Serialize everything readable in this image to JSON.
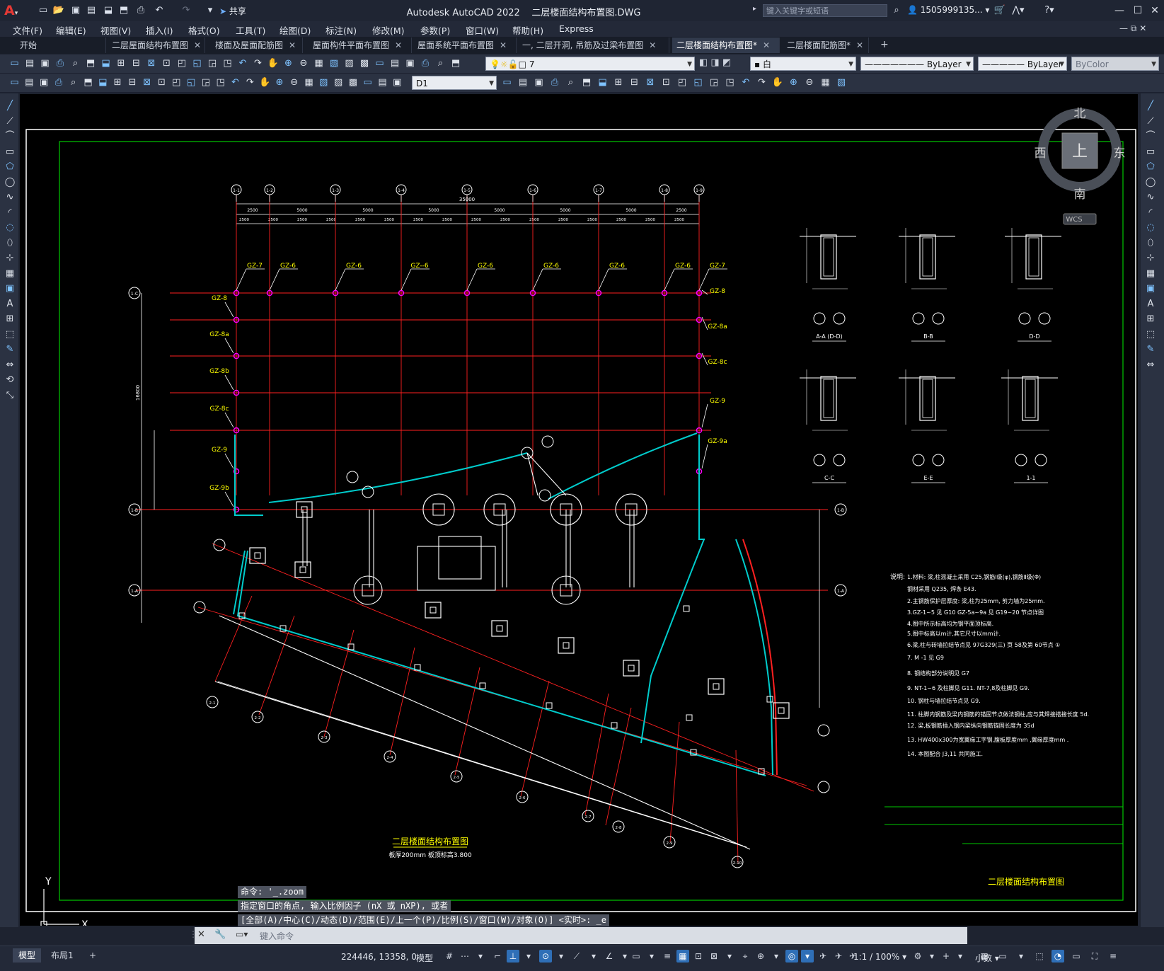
{
  "titlebar": {
    "app_title": "Autodesk AutoCAD 2022",
    "file_name": "二层楼面结构布置图.DWG",
    "share_label": "共享",
    "search_placeholder": "键入关键字或短语",
    "user": "1505999135..."
  },
  "menu": [
    "文件(F)",
    "编辑(E)",
    "视图(V)",
    "插入(I)",
    "格式(O)",
    "工具(T)",
    "绘图(D)",
    "标注(N)",
    "修改(M)",
    "参数(P)",
    "窗口(W)",
    "帮助(H)",
    "Express"
  ],
  "tabs": [
    {
      "label": "开始",
      "active": false
    },
    {
      "label": "二层屋面结构布置图",
      "active": false
    },
    {
      "label": "楼面及屋面配筋图",
      "active": false
    },
    {
      "label": "屋面构件平面布置图",
      "active": false
    },
    {
      "label": "屋面系统平面布置图",
      "active": false
    },
    {
      "label": "一, 二层开洞, 吊筋及过梁布置图",
      "active": false
    },
    {
      "label": "二层楼面结构布置图*",
      "active": true
    },
    {
      "label": "二层楼面配筋图*",
      "active": false
    }
  ],
  "toolbar": {
    "layer_value": "7",
    "color_value": "白",
    "linetype_value": "ByLayer",
    "lineweight_value": "ByLayer",
    "plotstyle_value": "ByColor",
    "dim_style": "D1"
  },
  "viewcube": {
    "north": "北",
    "south": "南",
    "east": "东",
    "west": "西",
    "top": "上",
    "wcs": "WCS"
  },
  "drawing": {
    "grid_top": [
      "1-1",
      "1-2",
      "1-3",
      "1-4",
      "1-5",
      "1-6",
      "1-7",
      "1-8",
      "1-9"
    ],
    "grid_left": [
      "1-C",
      "1-B",
      "1-A"
    ],
    "grid_bottom": [
      "2-1",
      "2-2",
      "2-3",
      "2-4",
      "2-5",
      "2-6",
      "2-7",
      "2-8",
      "2-9",
      "2-10"
    ],
    "dims_top1": [
      "2500",
      "5000",
      "5000",
      "5000",
      "5000",
      "5000",
      "5000",
      "2500"
    ],
    "dims_top2": [
      "2500",
      "2500",
      "2500",
      "2500",
      "2500",
      "2500",
      "2500",
      "2500",
      "2500",
      "2500",
      "2500",
      "2500",
      "2500",
      "2500",
      "2500",
      "2500"
    ],
    "total_dim": "35000",
    "gz_top": [
      "GZ-7",
      "GZ-6",
      "GZ-6",
      "GZ--6",
      "GZ-6",
      "GZ-6",
      "GZ-6",
      "GZ-6",
      "GZ-7"
    ],
    "gz_left": [
      "GZ-8",
      "GZ-8a",
      "GZ-8b",
      "GZ-8c",
      "GZ-9",
      "GZ-9b"
    ],
    "gz_right": [
      "GZ-8",
      "GZ-8a",
      "GZ-8c",
      "GZ-9",
      "GZ-9a"
    ],
    "sections": [
      "A-A D-D",
      "B-B",
      "D-D",
      "C-C",
      "E-E",
      "1-1"
    ],
    "notes_title": "说明:",
    "notes": [
      "1.材料: 梁,柱混凝土采用 C25,钢筋Ⅰ级(φ),钢筋Ⅱ级(Φ)",
      "  钢材采用 Q235, 焊条 E43.",
      "2.主钢筋保护层厚度: 梁,柱为25mm, 剪力墙为25mm.",
      "3.GZ-1~5 见 G10  GZ-5a~9a 见 G19~20 节点详图",
      "4.图中所示标高均为钢平面顶标高.",
      "5.图中标高以m计,其它尺寸以mm计.",
      "6.梁,柱与砖墙拉结节点见  97G329(三) 页 58及第 60节点 ①",
      "7. M -1 见 G9",
      "8. 钢结构部分说明见 G7",
      "9. NT-1~6 及柱脚见 G11. NT-7,8及柱脚见 G9.",
      "10. 钢柱与墙拉结节点见 G9.",
      "11. 柱脚内钢筋及梁内钢筋的锚固节点做法钢柱,应与其焊接搭接长度 5d.",
      "12. 梁,板钢筋插入钢内梁纵向钢筋锚固长度为 35d",
      "13. HW400x300为宽翼缘工字钢,腹板厚度mm  ,翼缘厚度mm  .",
      "14. 本图配合 J3,11 共同施工."
    ],
    "plan_title": "二层楼面结构布置图",
    "plan_subtitle": "板厚200mm  板顶标高3.800",
    "titleblock_name": "二层楼面结构布置图",
    "axis_y": "Y",
    "axis_x": "X"
  },
  "command": {
    "history": [
      "命令: '_.zoom",
      "指定窗口的角点, 输入比例因子 (nX 或 nXP), 或者",
      "[全部(A)/中心(C)/动态(D)/范围(E)/上一个(P)/比例(S)/窗口(W)/对象(O)] <实时>: _e"
    ],
    "placeholder": "键入命令"
  },
  "status": {
    "tab_model": "模型",
    "tab_layout": "布局1",
    "coords": "224446, 13358, 0",
    "space": "模型",
    "scale": "1:1 / 100%",
    "units": "小数"
  },
  "colors": {
    "grid_line": "#ff2020",
    "wall": "#00cccc",
    "border": "#00c800",
    "label_yellow": "#ffff00",
    "magenta": "#ff00ff",
    "white_line": "#ffffff"
  }
}
